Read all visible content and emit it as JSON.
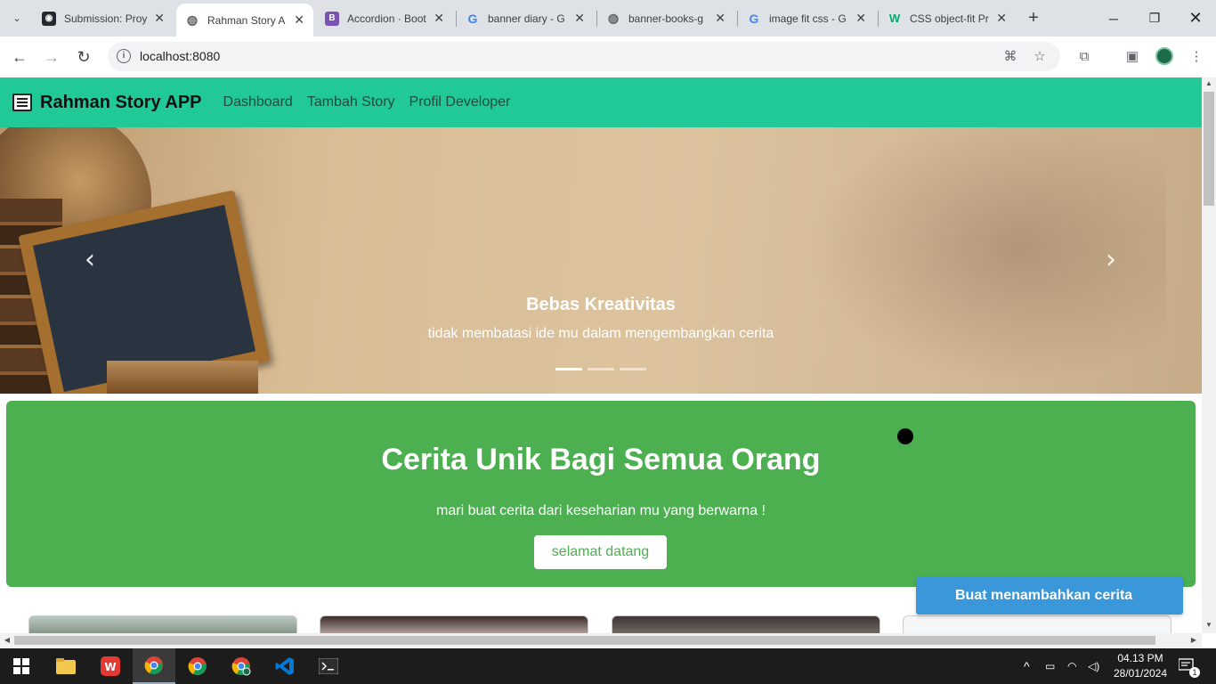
{
  "browser": {
    "tabs": [
      {
        "title": "Submission: Proy",
        "favicon": "github-icon",
        "active": false
      },
      {
        "title": "Rahman Story A",
        "favicon": "globe-icon",
        "active": true
      },
      {
        "title": "Accordion · Boot",
        "favicon": "bootstrap-icon",
        "active": false
      },
      {
        "title": "banner diary - G",
        "favicon": "google-icon",
        "active": false
      },
      {
        "title": "banner-books-g",
        "favicon": "globe-icon",
        "active": false
      },
      {
        "title": "image fit css - G",
        "favicon": "google-icon",
        "active": false
      },
      {
        "title": "CSS object-fit Pr",
        "favicon": "w3schools-icon",
        "active": false
      }
    ],
    "url": "localhost:8080"
  },
  "navbar": {
    "brand": "Rahman Story APP",
    "links": [
      "Dashboard",
      "Tambah Story",
      "Profil Developer"
    ],
    "color": "#20c997"
  },
  "carousel": {
    "caption_title": "Bebas Kreativitas",
    "caption_text": "tidak membatasi ide mu dalam mengembangkan cerita",
    "slide_count": 3,
    "active_slide": 1
  },
  "hero": {
    "title": "Cerita Unik Bagi Semua Orang",
    "subtitle": "mari buat cerita dari keseharian mu yang berwarna !",
    "button": "selamat datang",
    "color": "#4caf50"
  },
  "floating_button": {
    "label": "Buat menambahkan cerita",
    "color": "#3a97d9"
  },
  "taskbar": {
    "time": "04.13 PM",
    "date": "28/01/2024",
    "notification_count": "1"
  }
}
